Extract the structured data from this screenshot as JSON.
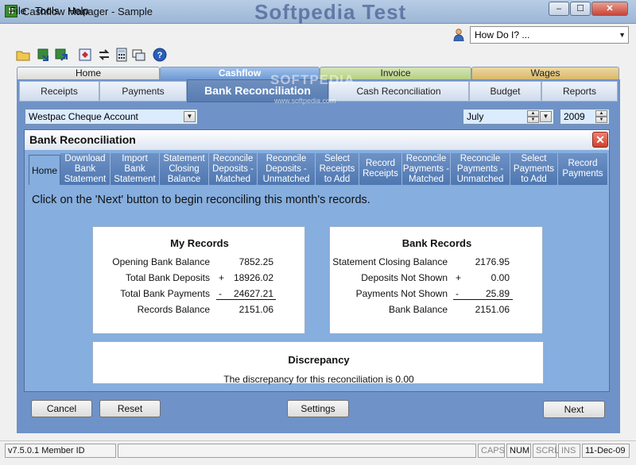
{
  "window": {
    "title": "Cashflow Manager - Sample",
    "watermark": "Softpedia Test",
    "minimize_glyph": "–",
    "maximize_glyph": "☐",
    "close_glyph": "✕"
  },
  "menu": {
    "file": "File",
    "tools": "Tools",
    "help": "Help"
  },
  "help_search": {
    "value": "How Do I? ..."
  },
  "top_tabs": {
    "home": "Home",
    "cashflow": "Cashflow",
    "invoice": "Invoice",
    "wages": "Wages"
  },
  "sub_tabs": {
    "receipts": "Receipts",
    "payments": "Payments",
    "bank_rec": "Bank Reconciliation",
    "cash_rec": "Cash Reconciliation",
    "budget": "Budget",
    "reports": "Reports"
  },
  "watermarks": {
    "softpedia": "SOFTPEDIA",
    "softpedia_url": "www.softpedia.com"
  },
  "filters": {
    "account": "Westpac Cheque Account",
    "month": "July",
    "year": "2009"
  },
  "inner": {
    "title": "Bank Reconciliation",
    "close_glyph": "✕"
  },
  "steps": [
    "Home",
    "Download Bank Statement",
    "Import Bank Statement",
    "Statement Closing Balance",
    "Reconcile Deposits - Matched",
    "Reconcile Deposits - Unmatched",
    "Select Receipts to Add",
    "Record Receipts",
    "Reconcile Payments - Matched",
    "Reconcile Payments - Unmatched",
    "Select Payments to Add",
    "Record Payments"
  ],
  "instruction": "Click on the 'Next' button to begin reconciling this month's records.",
  "my_records": {
    "title": "My Records",
    "rows": [
      {
        "label": "Opening Bank Balance",
        "sign": "",
        "value": "7852.25"
      },
      {
        "label": "Total Bank Deposits",
        "sign": "+",
        "value": "18926.02"
      },
      {
        "label": "Total Bank Payments",
        "sign": "-",
        "value": "24627.21"
      },
      {
        "label": "Records Balance",
        "sign": "",
        "value": "2151.06"
      }
    ]
  },
  "bank_records": {
    "title": "Bank Records",
    "rows": [
      {
        "label": "Statement Closing Balance",
        "sign": "",
        "value": "2176.95"
      },
      {
        "label": "Deposits Not Shown",
        "sign": "+",
        "value": "0.00"
      },
      {
        "label": "Payments Not Shown",
        "sign": "-",
        "value": "25.89"
      },
      {
        "label": "Bank Balance",
        "sign": "",
        "value": "2151.06"
      }
    ]
  },
  "discrepancy": {
    "title": "Discrepancy",
    "text": "The discrepancy for this reconciliation is 0.00"
  },
  "buttons": {
    "cancel": "Cancel",
    "reset": "Reset",
    "settings": "Settings",
    "next": "Next"
  },
  "status": {
    "version": "v7.5.0.1 Member ID",
    "caps": "CAPS",
    "num": "NUM",
    "scrl": "SCRL",
    "ins": "INS",
    "date": "11-Dec-09"
  }
}
